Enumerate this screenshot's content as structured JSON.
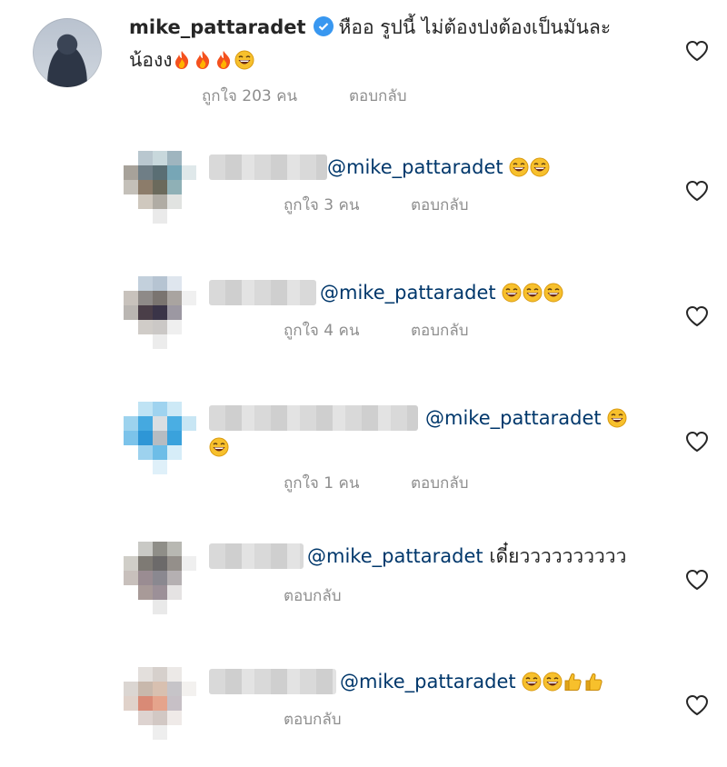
{
  "main_comment": {
    "username": "mike_pattaradet",
    "text_line1": "หืออ รูปนี้ ไม่ต้องปงต้องเป็นมันละ",
    "text_line2": "น้องง",
    "likes": "ถูกใจ 203 คน",
    "reply": "ตอบกลับ"
  },
  "replies": [
    {
      "mention": "@mike_pattaradet",
      "text": "",
      "likes": "ถูกใจ 3 คน",
      "reply": "ตอบกลับ"
    },
    {
      "mention": "@mike_pattaradet",
      "text": "",
      "likes": "ถูกใจ 4 คน",
      "reply": "ตอบกลับ"
    },
    {
      "mention": "@mike_pattaradet",
      "text": "",
      "likes": "ถูกใจ 1 คน",
      "reply": "ตอบกลับ"
    },
    {
      "mention": "@mike_pattaradet",
      "text": "เดี๋ยวววววววววว",
      "likes": "",
      "reply": "ตอบกลับ"
    },
    {
      "mention": "@mike_pattaradet",
      "text": "",
      "likes": "",
      "reply": "ตอบกลับ"
    }
  ],
  "icons": {
    "heart": "heart-outline-icon",
    "verified": "verified-badge-icon",
    "fire": "fire-emoji",
    "laugh": "grinning-sweat-emoji",
    "thumbs_up": "thumbs-up-emoji"
  },
  "colors": {
    "mention": "#00376b",
    "meta": "#8e8e8e",
    "verified": "#3897f0"
  }
}
